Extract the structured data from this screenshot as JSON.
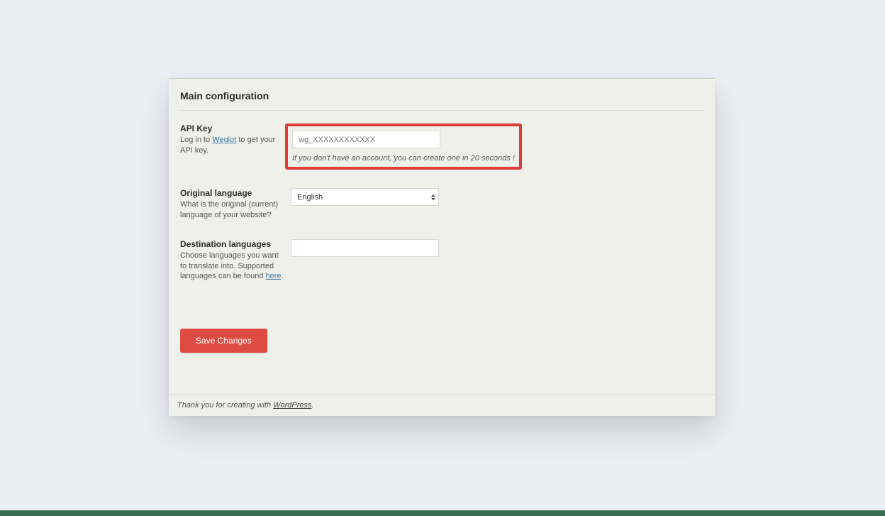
{
  "section": {
    "title": "Main configuration"
  },
  "apiKey": {
    "label": "API Key",
    "desc_prefix": "Log in to ",
    "desc_link": "Weglot",
    "desc_suffix": " to get your API key.",
    "placeholder": "wg_XXXXXXXXXXXX",
    "value": "",
    "hint": "If you don't have an account, you can create one in 20 seconds !"
  },
  "originalLang": {
    "label": "Original language",
    "desc": "What is the original (current) language of your website?",
    "selected": "English"
  },
  "destLang": {
    "label": "Destination languages",
    "desc_prefix": "Choose languages you want to translate into. Supported languages can be found ",
    "desc_link": "here",
    "desc_suffix": ".",
    "value": ""
  },
  "buttons": {
    "save": "Save Changes"
  },
  "footer": {
    "prefix": "Thank you for creating with ",
    "link": "WordPress",
    "suffix": "."
  }
}
